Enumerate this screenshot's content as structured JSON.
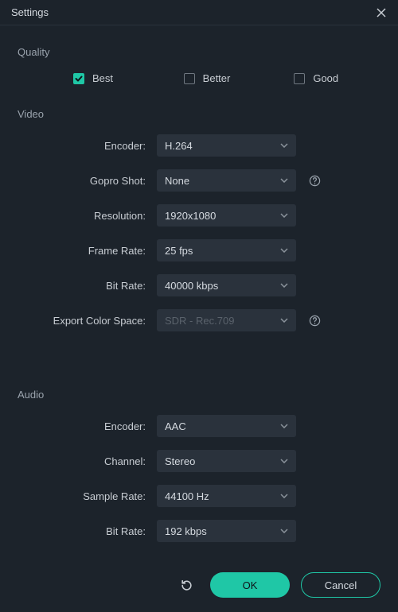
{
  "title": "Settings",
  "sections": {
    "quality": {
      "label": "Quality"
    },
    "video": {
      "label": "Video"
    },
    "audio": {
      "label": "Audio"
    }
  },
  "quality_options": [
    {
      "label": "Best",
      "checked": true
    },
    {
      "label": "Better",
      "checked": false
    },
    {
      "label": "Good",
      "checked": false
    }
  ],
  "video": {
    "encoder": {
      "label": "Encoder:",
      "value": "H.264"
    },
    "gopro": {
      "label": "Gopro Shot:",
      "value": "None"
    },
    "resolution": {
      "label": "Resolution:",
      "value": "1920x1080"
    },
    "framerate": {
      "label": "Frame Rate:",
      "value": "25 fps"
    },
    "bitrate": {
      "label": "Bit Rate:",
      "value": "40000 kbps"
    },
    "colorspace": {
      "label": "Export Color Space:",
      "value": "SDR - Rec.709"
    }
  },
  "audio": {
    "encoder": {
      "label": "Encoder:",
      "value": "AAC"
    },
    "channel": {
      "label": "Channel:",
      "value": "Stereo"
    },
    "samplerate": {
      "label": "Sample Rate:",
      "value": "44100 Hz"
    },
    "bitrate": {
      "label": "Bit Rate:",
      "value": "192 kbps"
    }
  },
  "buttons": {
    "ok": "OK",
    "cancel": "Cancel"
  },
  "colors": {
    "accent": "#1fc7a6",
    "bg": "#1c232b",
    "panel": "#2a323c"
  }
}
